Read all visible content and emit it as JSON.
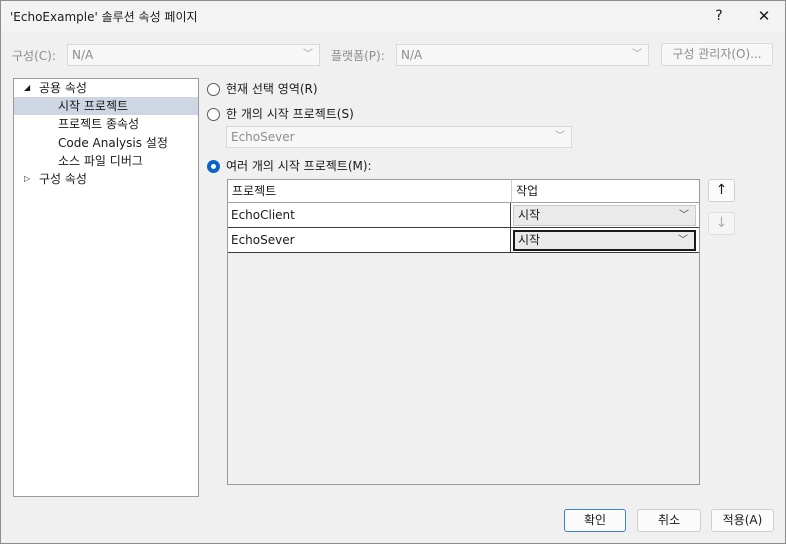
{
  "window": {
    "title": "'EchoExample' 솔루션 속성 페이지",
    "help_label": "?",
    "close_label": "✕"
  },
  "config_bar": {
    "config_label": "구성(C):",
    "config_value": "N/A",
    "platform_label": "플랫폼(P):",
    "platform_value": "N/A",
    "config_manager_label": "구성 관리자(O)..."
  },
  "tree": {
    "items": [
      {
        "label": "공용 속성",
        "expanded": true
      },
      {
        "label": "시작 프로젝트",
        "selected": true
      },
      {
        "label": "프로젝트 종속성"
      },
      {
        "label": "Code Analysis 설정"
      },
      {
        "label": "소스 파일 디버그"
      },
      {
        "label": "구성 속성",
        "expanded": false
      }
    ]
  },
  "startup": {
    "option_current": "현재 선택 영역(R)",
    "option_single": "한 개의 시작 프로젝트(S)",
    "single_value": "EchoSever",
    "option_multiple": "여러 개의 시작 프로젝트(M):",
    "selected_option": "multiple"
  },
  "grid": {
    "headers": [
      "프로젝트",
      "작업"
    ],
    "rows": [
      {
        "project": "EchoClient",
        "action": "시작"
      },
      {
        "project": "EchoSever",
        "action": "시작"
      }
    ],
    "move_up": "↑",
    "move_down": "↓"
  },
  "footer": {
    "ok_label": "확인",
    "cancel_label": "취소",
    "apply_label": "적용(A)"
  },
  "colors": {
    "accent": "#0a63c9",
    "selection": "#cfd6e3"
  }
}
